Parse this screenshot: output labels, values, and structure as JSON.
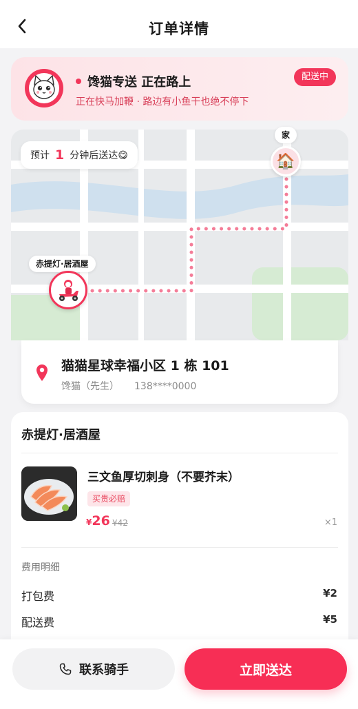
{
  "header": {
    "title": "订单详情"
  },
  "status": {
    "title": "馋猫专送 正在路上",
    "subtitle": "正在快马加鞭 · 路边有小鱼干也绝不停下",
    "badge": "配送中",
    "accent_color": "#f2365a"
  },
  "map": {
    "eta_prefix": "预计",
    "eta_minutes": "1",
    "eta_suffix": "分钟后送达😋",
    "home_label": "家",
    "home_icon": "🏠",
    "shop_label": "赤提灯·居酒屋"
  },
  "address": {
    "line": "猫猫星球幸福小区 1 栋 101",
    "name": "馋猫（先生）",
    "phone": "138****0000"
  },
  "order": {
    "shop_name": "赤提灯·居酒屋",
    "item": {
      "name": "三文鱼厚切刺身（不要芥末）",
      "tag": "买贵必赔",
      "currency": "¥",
      "price": "26",
      "original_price": "¥42",
      "quantity": "×1"
    },
    "fees_title": "费用明细",
    "fees": [
      {
        "label": "打包费",
        "amount": "¥2"
      },
      {
        "label": "配送费",
        "amount": "¥5"
      }
    ]
  },
  "actions": {
    "contact_label": "联系骑手",
    "deliver_label": "立即送达"
  }
}
